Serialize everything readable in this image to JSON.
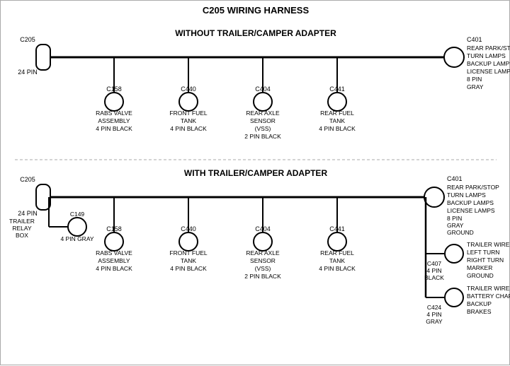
{
  "title": "C205 WIRING HARNESS",
  "section1": {
    "label": "WITHOUT TRAILER/CAMPER ADAPTER",
    "left_connector": {
      "id": "C205",
      "pins": "24 PIN"
    },
    "right_connector": {
      "id": "C401",
      "pins": "8 PIN",
      "color": "GRAY",
      "description": [
        "REAR PARK/STOP",
        "TURN LAMPS",
        "BACKUP LAMPS",
        "LICENSE LAMPS"
      ]
    },
    "sub_connectors": [
      {
        "id": "C158",
        "lines": [
          "RABS VALVE",
          "ASSEMBLY",
          "4 PIN BLACK"
        ]
      },
      {
        "id": "C440",
        "lines": [
          "FRONT FUEL",
          "TANK",
          "4 PIN BLACK"
        ]
      },
      {
        "id": "C404",
        "lines": [
          "REAR AXLE",
          "SENSOR",
          "(VSS)",
          "2 PIN BLACK"
        ]
      },
      {
        "id": "C441",
        "lines": [
          "REAR FUEL",
          "TANK",
          "4 PIN BLACK"
        ]
      }
    ]
  },
  "section2": {
    "label": "WITH TRAILER/CAMPER ADAPTER",
    "left_connector": {
      "id": "C205",
      "pins": "24 PIN"
    },
    "trailer_relay": {
      "label": "TRAILER RELAY BOX",
      "sub_id": "C149",
      "sub_pins": "4 PIN GRAY"
    },
    "right_connector": {
      "id": "C401",
      "pins": "8 PIN",
      "color": "GRAY",
      "description": [
        "REAR PARK/STOP",
        "TURN LAMPS",
        "BACKUP LAMPS",
        "LICENSE LAMPS",
        "GROUND"
      ]
    },
    "sub_connectors": [
      {
        "id": "C158",
        "lines": [
          "RABS VALVE",
          "ASSEMBLY",
          "4 PIN BLACK"
        ]
      },
      {
        "id": "C440",
        "lines": [
          "FRONT FUEL",
          "TANK",
          "4 PIN BLACK"
        ]
      },
      {
        "id": "C404",
        "lines": [
          "REAR AXLE",
          "SENSOR",
          "(VSS)",
          "2 PIN BLACK"
        ]
      },
      {
        "id": "C441",
        "lines": [
          "REAR FUEL",
          "TANK",
          "4 PIN BLACK"
        ]
      }
    ],
    "right_sub_connectors": [
      {
        "id": "C407",
        "pins": "4 PIN",
        "color": "BLACK",
        "lines": [
          "TRAILER WIRES",
          "LEFT TURN",
          "RIGHT TURN",
          "MARKER",
          "GROUND"
        ]
      },
      {
        "id": "C424",
        "pins": "4 PIN",
        "color": "GRAY",
        "lines": [
          "TRAILER WIRES",
          "BATTERY CHARGE",
          "BACKUP",
          "BRAKES"
        ]
      }
    ]
  }
}
